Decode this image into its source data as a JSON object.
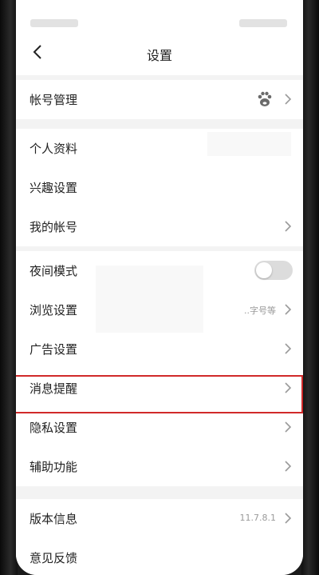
{
  "header": {
    "title": "设置"
  },
  "groups": [
    {
      "items": [
        {
          "label": "帐号管理"
        }
      ]
    },
    {
      "items": [
        {
          "label": "个人资料"
        },
        {
          "label": "兴趣设置"
        },
        {
          "label": "我的帐号"
        }
      ]
    },
    {
      "items": [
        {
          "label": "夜间模式",
          "toggle": false
        },
        {
          "label": "浏览设置",
          "value": "..字号等"
        },
        {
          "label": "广告设置"
        },
        {
          "label": "消息提醒"
        },
        {
          "label": "隐私设置"
        },
        {
          "label": "辅助功能"
        }
      ]
    },
    {
      "items": [
        {
          "label": "版本信息",
          "value": "11.7.8.1"
        },
        {
          "label": "意见反馈"
        }
      ]
    }
  ],
  "colors": {
    "accent": "#d12a2a",
    "background": "#f3f3f3",
    "surface": "#ffffff"
  },
  "icons": {
    "back": "chevron-left-icon",
    "avatar": "baidu-paw-icon",
    "chevron": "chevron-right-icon"
  }
}
